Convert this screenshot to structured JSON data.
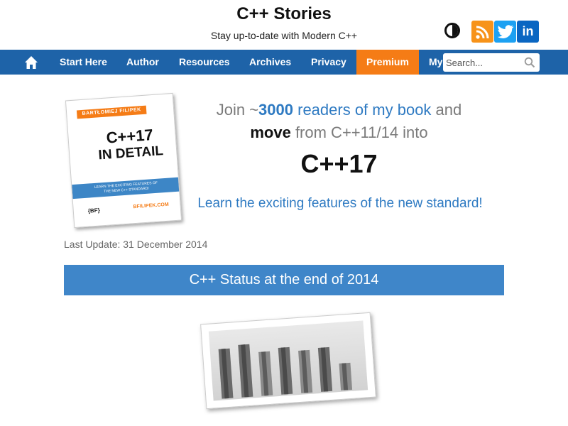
{
  "header": {
    "title": "C++ Stories",
    "tagline": "Stay up-to-date with Modern C++",
    "icons": [
      "contrast-toggle-icon",
      "rss-icon",
      "twitter-icon",
      "linkedin-icon"
    ],
    "linkedin_text": "in"
  },
  "nav": {
    "items": [
      {
        "label": "Start Here"
      },
      {
        "label": "Author"
      },
      {
        "label": "Resources"
      },
      {
        "label": "Archives"
      },
      {
        "label": "Privacy"
      },
      {
        "label": "Premium"
      },
      {
        "label": "My"
      }
    ],
    "search_placeholder": "Search..."
  },
  "banner": {
    "book": {
      "author": "BARTŁOMIEJ FILIPEK",
      "title_line1": "C++17",
      "title_line2": "IN DETAIL",
      "stripe_line1": "LEARN THE EXCITING FEATURES OF",
      "stripe_line2": "THE NEW C++ STANDARD!",
      "publisher": "{BF}",
      "url": "BFILIPEK.COM"
    },
    "line1_a": "Join ~",
    "line1_b": "3000",
    "line1_c": " readers of my book",
    "line1_d": " and",
    "line2_a": "move",
    "line2_b": " from C++11/14 into",
    "line3": "C++17",
    "line4": "Learn the exciting features of the new standard!"
  },
  "post": {
    "last_update": "Last Update: 31 December 2014",
    "section_title": "C++ Status at the end of 2014"
  },
  "colors": {
    "nav_bg": "#1e63a8",
    "premium": "#f57c16",
    "section_bar": "#3f86c9"
  }
}
